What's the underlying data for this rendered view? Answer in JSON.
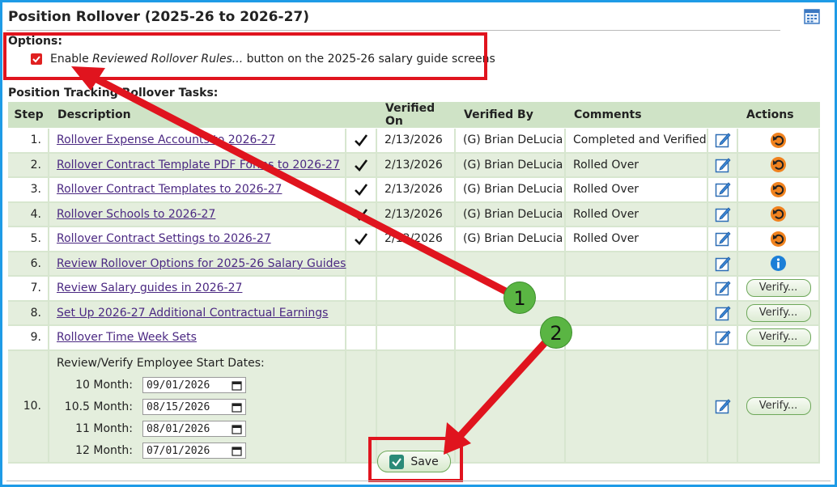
{
  "page": {
    "title": "Position Rollover (2025-26 to 2026-27)",
    "options_label": "Options:",
    "option": {
      "checked": true,
      "prefix": "Enable",
      "italic": "Reviewed Rollover Rules...",
      "suffix": "button on the 2025-26 salary guide screens"
    },
    "tasks_label": "Position Tracking Rollover Tasks:"
  },
  "table": {
    "headers": {
      "step": "Step",
      "description": "Description",
      "verified_on": "Verified On",
      "verified_by": "Verified By",
      "comments": "Comments",
      "actions": "Actions"
    },
    "rows": [
      {
        "step": "1.",
        "description": "Rollover Expense Accounts to 2026-27",
        "verified": true,
        "verified_on": "2/13/2026",
        "verified_by": "(G) Brian DeLucia",
        "comments": "Completed and Verified",
        "action": "undo-icon"
      },
      {
        "step": "2.",
        "description": "Rollover Contract Template PDF Forms to 2026-27",
        "verified": true,
        "verified_on": "2/13/2026",
        "verified_by": "(G) Brian DeLucia",
        "comments": "Rolled Over",
        "action": "undo-icon"
      },
      {
        "step": "3.",
        "description": "Rollover Contract Templates to 2026-27",
        "verified": true,
        "verified_on": "2/13/2026",
        "verified_by": "(G) Brian DeLucia",
        "comments": "Rolled Over",
        "action": "undo-icon"
      },
      {
        "step": "4.",
        "description": "Rollover Schools to 2026-27",
        "verified": true,
        "verified_on": "2/13/2026",
        "verified_by": "(G) Brian DeLucia",
        "comments": "Rolled Over",
        "action": "undo-icon"
      },
      {
        "step": "5.",
        "description": "Rollover Contract Settings to 2026-27",
        "verified": true,
        "verified_on": "2/13/2026",
        "verified_by": "(G) Brian DeLucia",
        "comments": "Rolled Over",
        "action": "undo-icon"
      },
      {
        "step": "6.",
        "description": "Review Rollover Options for 2025-26 Salary Guides",
        "verified": false,
        "verified_on": "",
        "verified_by": "",
        "comments": "",
        "action": "info-icon"
      },
      {
        "step": "7.",
        "description": "Review Salary guides in 2026-27",
        "verified": false,
        "verified_on": "",
        "verified_by": "",
        "comments": "",
        "action": "Verify..."
      },
      {
        "step": "8.",
        "description": "Set Up 2026-27 Additional Contractual Earnings",
        "verified": false,
        "verified_on": "",
        "verified_by": "",
        "comments": "",
        "action": "Verify..."
      },
      {
        "step": "9.",
        "description": "Rollover Time Week Sets",
        "verified": false,
        "verified_on": "",
        "verified_by": "",
        "comments": "",
        "action": "Verify..."
      }
    ],
    "start_dates": {
      "step": "10.",
      "heading": "Review/Verify Employee Start Dates:",
      "dates": [
        {
          "label": "10 Month:",
          "value": "09/01/2026"
        },
        {
          "label": "10.5 Month:",
          "value": "08/15/2026"
        },
        {
          "label": "11 Month:",
          "value": "08/01/2026"
        },
        {
          "label": "12 Month:",
          "value": "07/01/2026"
        }
      ],
      "action": "Verify..."
    }
  },
  "save_label": "Save",
  "annotations": {
    "badge_1": "1",
    "badge_2": "2",
    "highlight_color": "#e0141e",
    "badge_color": "#5ab543"
  }
}
